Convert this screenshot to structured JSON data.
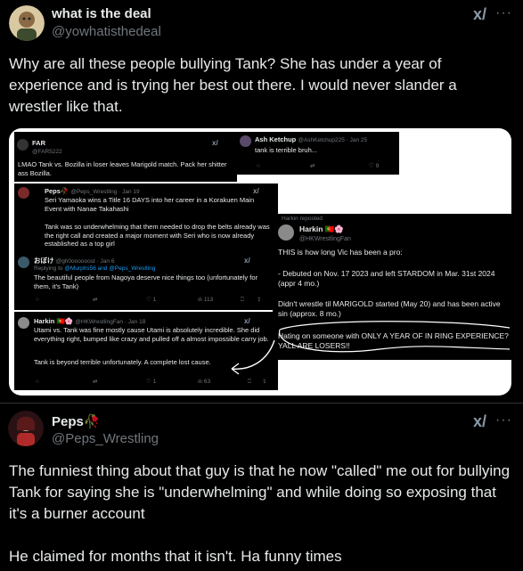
{
  "post1": {
    "author_name": "what is the deal",
    "author_handle": "@yowhatisthedeal",
    "text": "Why are all these people bullying Tank? She has under a year of experience and is trying her best out there. I would never slander a wrestler like that."
  },
  "embedded": {
    "far": {
      "name": "FAR",
      "handle": "@FAR5222",
      "text": "LMAO Tank vs. Bozilla in loser leaves Marigold match. Pack her shitter ass Bozilla."
    },
    "ash": {
      "name": "Ash Ketchup",
      "handle": "@AshKetchup225 · Jan 25",
      "text": "tank is terrible bruh...",
      "like_count": "9"
    },
    "peps": {
      "name": "Peps🥀",
      "handle": "@Peps_Wrestling · Jan 19",
      "text1": "Seri Yamaoka wins a Title 16 DAYS into her career in a Korakuen Main Event with Nanae Takahashi",
      "text2": "Tank was so underwhelming that them needed to drop the belts already was the right call and created a major moment with Seri who is now already established as a top girl"
    },
    "hoshi": {
      "name": "おぼけ",
      "handle": "@gh0oooooost · Jan 6",
      "reply_prefix": "Replying to",
      "reply_to": "@Murphs56 and @Peps_Wrestling",
      "text": "The beautiful people from Nagoya deserve nice things too (unfortunately for them, it's Tank)",
      "like_count": "1",
      "view_count": "113"
    },
    "harkin_right": {
      "reposted": "Harkin reposted",
      "name": "Harkin",
      "flag": "🇵🇹🌸",
      "handle": "@HKWrestlingFan",
      "line1": "THIS is how long Vic has been a pro:",
      "line2": "- Debuted on Nov. 17 2023 and left STARDOM in Mar. 31st 2024 (appr 4 mo.)",
      "line3": "Didn't wrestle til MARIGOLD started (May 20) and has been active sin (approx. 8 mo.)",
      "line4": "Hating on someone with ONLY A YEAR OF IN RING EXPERIENCE? YALL ARE LOSERS!!"
    },
    "harkin_left": {
      "name": "Harkin",
      "flag": "🇵🇹🌸",
      "handle": "@HKWrestlingFan · Jan 18",
      "text1": "Utami vs. Tank was fine mostly cause Utami is absolutely incredible. She did everything right, bumped like crazy and pulled off a almost impossible carry job.",
      "text2": "Tank is beyond terrible unfortunately. A complete lost cause.",
      "like_count": "1",
      "view_count": "63"
    }
  },
  "post2": {
    "author_name": "Peps🥀",
    "author_handle": "@Peps_Wrestling",
    "text1": "The funniest thing about that guy is that he now \"called\" me out for bullying Tank for saying she is \"underwhelming\" and while doing so exposing that it's a burner account",
    "text2": "He claimed for months that it isn't. Ha funny times"
  },
  "grok_label": "x/",
  "more_label": "···",
  "icons": [
    "reply-icon",
    "repost-icon",
    "like-icon",
    "views-icon",
    "bookmark-icon",
    "share-icon",
    "grok-icon",
    "more-icon"
  ]
}
